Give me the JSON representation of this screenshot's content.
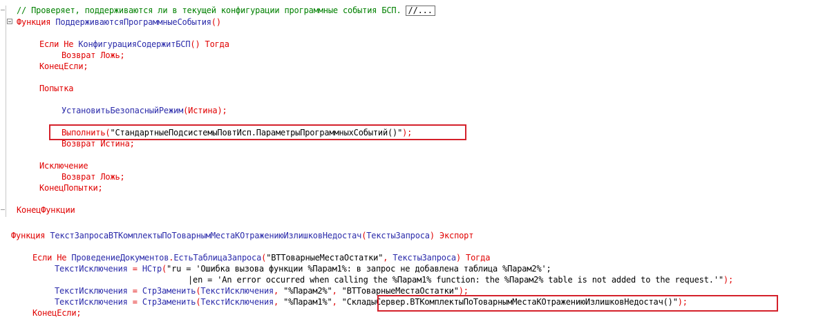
{
  "top_block": {
    "comment": "// Проверяет, поддерживаются ли в текущей конфигурации программные события БСП.",
    "collapsed_marker": "//...",
    "func_kw": "Функция",
    "func_name": "ПоддерживаютсяПрограммныеСобытия",
    "func_parens": "()",
    "if_kw": "Если",
    "not_kw": "Не",
    "if_call": "КонфигурацияСодержитБСП",
    "if_parens": "()",
    "then_kw": "Тогда",
    "return_kw_1": "Возврат",
    "false_1": "Ложь",
    "semicolon": ";",
    "endif_kw": "КонецЕсли",
    "try_kw": "Попытка",
    "safe_mode_call": "УстановитьБезопасныйРежим",
    "safe_mode_arg": "Истина",
    "exec_call": "Выполнить",
    "exec_arg": "\"СтандартныеПодсистемыПовтИсп.ПараметрыПрограммныхСобытий()\"",
    "return_kw_2": "Возврат",
    "true_2": "Истина",
    "except_kw": "Исключение",
    "return_kw_3": "Возврат",
    "false_3": "Ложь",
    "endtry_kw": "КонецПопытки",
    "endfunc_kw": "КонецФункции"
  },
  "bottom_block": {
    "func_kw": "Функция",
    "func_name": "ТекстЗапросаВТКомплектыПоТоварнымМестаКОтражениюИзлишковНедостач",
    "func_param": "ТекстыЗапроса",
    "export_kw": "Экспорт",
    "if_kw": "Если",
    "not_kw": "Не",
    "if_module": "ПроведениеДокументов",
    "if_method": "ЕстьТаблицаЗапроса",
    "if_arg1": "\"ВТТоварныеМестаОстатки\"",
    "if_arg2": "ТекстыЗапроса",
    "then_kw": "Тогда",
    "exc_var": "ТекстИсключения",
    "nstr_call": "НСтр",
    "nstr_line1": "\"ru = 'Ошибка вызова функции %Парам1%: в запрос не добавлена таблица %Парам2%';",
    "nstr_line2": "|en = 'An error occurred when calling the %Парам1% function: the %Парам2% table is not added to the request.'\"",
    "replace_call": "СтрЗаменить",
    "replace1_arg2": "\"%Парам2%\"",
    "replace1_arg3": "\"ВТТоварныеМестаОстатки\"",
    "replace2_arg2": "\"%Парам1%\"",
    "replace2_arg3": "\"СкладыСервер.ВТКомплектыПоТоварнымМестаКОтражениюИзлишковНедостач()\"",
    "endif_kw": "КонецЕсли"
  },
  "colors": {
    "keyword": "#e00000",
    "identifier": "#2a2aaa",
    "string": "#000000",
    "comment": "#008000",
    "highlight_box": "#d4202a"
  }
}
